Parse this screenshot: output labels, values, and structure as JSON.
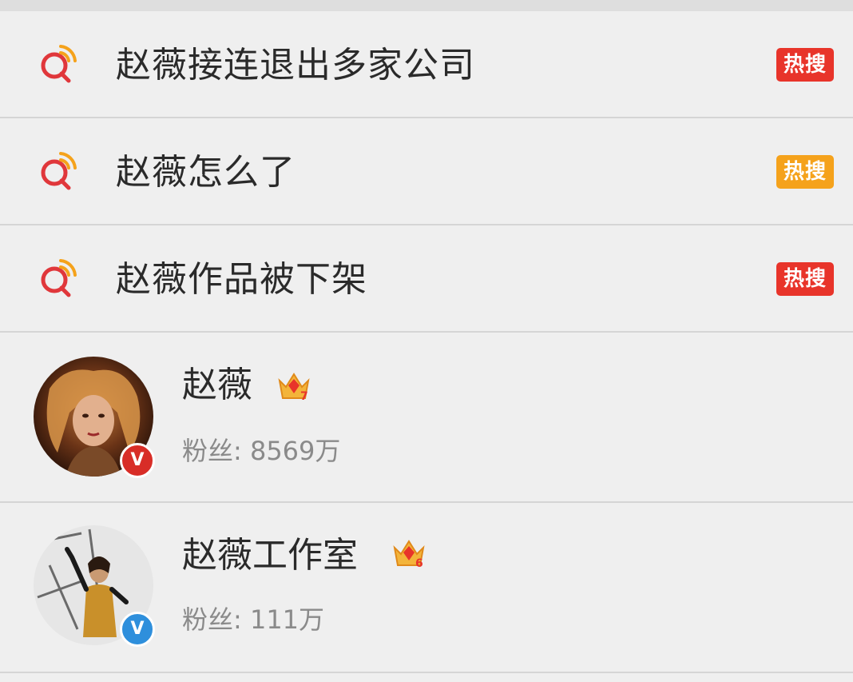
{
  "hot_searches": [
    {
      "text": "赵薇接连退出多家公司",
      "badge": "热搜",
      "badge_color": "#e8342a"
    },
    {
      "text": "赵薇怎么了",
      "badge": "热搜",
      "badge_color": "#f5a21b"
    },
    {
      "text": "赵薇作品被下架",
      "badge": "热搜",
      "badge_color": "#e8342a"
    }
  ],
  "users": [
    {
      "name": "赵薇",
      "fans_label": "粉丝: 8569万",
      "crown_level": "7",
      "verify_mark": "V",
      "verify_color": "#e8a317"
    },
    {
      "name": "赵薇工作室",
      "fans_label": "粉丝: 111万",
      "crown_level": "6",
      "verify_mark": "V",
      "verify_color": "#2e8fdc"
    }
  ],
  "icons": {
    "search": "search-icon",
    "crown": "crown-icon",
    "verified": "verified-badge-icon"
  },
  "colors": {
    "search_icon": "#e0373b",
    "crown": "#f3b43a",
    "background": "#efefef"
  }
}
